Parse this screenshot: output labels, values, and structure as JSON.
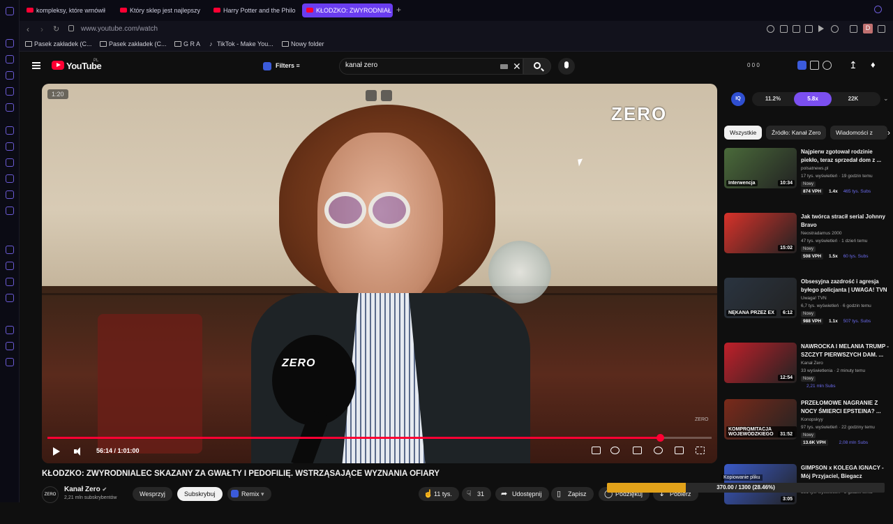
{
  "browser": {
    "tabs": [
      {
        "label": "kompleksy, które wmówił"
      },
      {
        "label": "Który sklep jest najlepszy"
      },
      {
        "label": "Harry Potter and the Philo"
      },
      {
        "label": "KŁODZKO: ZWYRODNIAŁ"
      }
    ],
    "new_tab": "+",
    "url": "www.youtube.com/watch",
    "profile_letter": "D",
    "bookmarks": [
      {
        "label": "Pasek zakładek (C..."
      },
      {
        "label": "Pasek zakładek (C..."
      },
      {
        "label": "G R A"
      },
      {
        "label": "TikTok - Make You..."
      },
      {
        "label": "Nowy folder"
      }
    ]
  },
  "youtube": {
    "logo_text": "YouTube",
    "region": "PL",
    "filters_label": "Filters",
    "search_value": "kanał zero",
    "header_counts": "0  0  0"
  },
  "player": {
    "timer_badge": "1:20",
    "logo": "ZERO",
    "watermark": "ZERO",
    "mic_label": "ZERO",
    "time": "56:14 / 1:01:00",
    "progress": 0.922,
    "buffered": 0.93
  },
  "video": {
    "title": "KŁODZKO: ZWYRODNIALEC SKAZANY ZA GWAŁTY I PEDOFILIĘ. WSTRZĄSAJĄCE WYZNANIA OFIARY",
    "channel": "Kanał Zero",
    "subscribers": "2,21 mln subskrybentów",
    "avatar_text": "ZERO",
    "buttons": {
      "support": "Wesprzyj",
      "subscribe": "Subskrybuj",
      "remix": "Remix",
      "likes": "11 tys.",
      "dislikes": "31",
      "share": "Udostępnij",
      "save": "Zapisz",
      "thanks": "Podziękuj",
      "download": "Pobierz"
    }
  },
  "iq_panel": {
    "badge": "IQ",
    "stats": [
      "11.2%",
      "5.8x",
      "22K"
    ]
  },
  "chips": [
    "Wszystkie",
    "Źródło: Kanał Zero",
    "Wiadomości z"
  ],
  "recommendations": [
    {
      "title": "Najpierw zgotował rodzinie piekło, teraz sprzedał dom z ...",
      "channel": "polsatnews.pl",
      "meta": "17 tys. wyświetleń · 19 godzin temu",
      "new": "Nowy",
      "vph": "874 VPH",
      "x": "1.4x",
      "subs": "465 tys. Subs",
      "duration": "10:34",
      "tag": "Interwencja",
      "thumb_color": "#4a6a3a"
    },
    {
      "title": "Jak twórca stracił serial Johnny Bravo",
      "channel": "Neostradamus 2000",
      "meta": "47 tys. wyświetleń · 1 dzień temu",
      "new": "Nowy",
      "vph": "508 VPH",
      "x": "1.5x",
      "subs": "60 tys. Subs",
      "duration": "15:02",
      "tag": "",
      "thumb_color": "#d8322a"
    },
    {
      "title": "Obsesyjna zazdrość i agresja byłego policjanta | UWAGA! TVN",
      "channel": "Uwaga! TVN",
      "meta": "6,7 tys. wyświetleń · 6 godzin temu",
      "new": "Nowy",
      "vph": "988 VPH",
      "x": "1.1x",
      "subs": "507 tys. Subs",
      "duration": "6:12",
      "tag": "NĘKANA PRZEZ EX",
      "thumb_color": "#2a3440"
    },
    {
      "title": "NAWROCKA I MELANIA TRUMP - SZCZYT PIERWSZYCH DAM. ...",
      "channel": "Kanał Zero",
      "meta": "33 wyświetlenia · 2 minuty temu",
      "new": "Nowy",
      "vph": "",
      "x": "",
      "subs": "2,21 mln Subs",
      "duration": "12:54",
      "tag": "",
      "thumb_color": "#c0202a"
    },
    {
      "title": "PRZEŁOMOWE NAGRANIE Z NOCY ŚMIERCI EPSTEINA? ...",
      "channel": "Konopskyy",
      "meta": "97 tys. wyświetleń · 22 godziny temu",
      "new": "Nowy",
      "vph": "13.6K VPH",
      "x": "",
      "subs": "2,08 mln Subs",
      "duration": "31:52",
      "tag": "KOMPROMITACJA WOJEWÓDZKIEGO",
      "thumb_color": "#7a2a1a"
    },
    {
      "title": "GIMPSON x KOLEGA IGNACY - Mój Przyjaciel, Biegacz",
      "channel": "",
      "meta": "381 tys. wyświetleń · 5 godzin temu",
      "new": "",
      "vph": "",
      "x": "",
      "subs": "",
      "duration": "3:05",
      "tag": "",
      "thumb_color": "#3a5ac8"
    }
  ],
  "download": {
    "label": "Kopiowanie pliku",
    "text": "370.00 / 1300 (28.46%)",
    "progress": 0.2846
  }
}
